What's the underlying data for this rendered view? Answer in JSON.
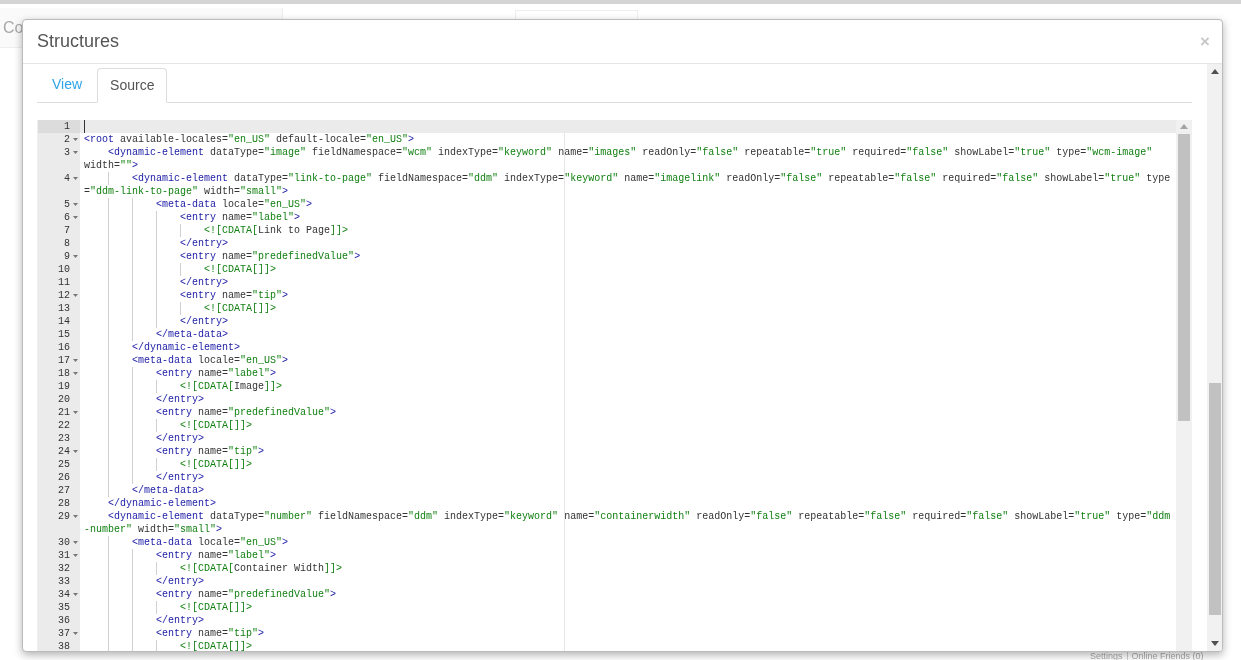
{
  "background": {
    "heading": "Co",
    "footer": [
      "Settings",
      "Online Friends (0)"
    ]
  },
  "dialog": {
    "title": "Structures",
    "close": "×",
    "tabs": [
      {
        "label": "View",
        "selected": false
      },
      {
        "label": "Source",
        "selected": true
      }
    ],
    "editor": {
      "lines": [
        {
          "number": "1",
          "foldable": false,
          "active": true
        },
        {
          "number": "2",
          "foldable": true,
          "active": false,
          "text": "<root available-locales=\"en_US\" default-locale=\"en_US\">"
        },
        {
          "number": "3",
          "foldable": true,
          "active": false,
          "text": "    <dynamic-element dataType=\"image\" fieldNamespace=\"wcm\" indexType=\"keyword\" name=\"images\" readOnly=\"false\" repeatable=\"true\" required=\"false\" showLabel=\"true\" type=\"wcm-image\"",
          "wrap": "width=\"\">"
        },
        {
          "number": "4",
          "foldable": true,
          "active": false,
          "text": "        <dynamic-element dataType=\"link-to-page\" fieldNamespace=\"ddm\" indexType=\"keyword\" name=\"imagelink\" readOnly=\"false\" repeatable=\"false\" required=\"false\" showLabel=\"true\" type",
          "wrap": "=\"ddm-link-to-page\" width=\"small\">"
        },
        {
          "number": "5",
          "foldable": true,
          "active": false,
          "text": "            <meta-data locale=\"en_US\">"
        },
        {
          "number": "6",
          "foldable": true,
          "active": false,
          "text": "                <entry name=\"label\">"
        },
        {
          "number": "7",
          "foldable": false,
          "active": false,
          "text": "                    <![CDATA[Link to Page]]>"
        },
        {
          "number": "8",
          "foldable": false,
          "active": false,
          "text": "                </entry>"
        },
        {
          "number": "9",
          "foldable": true,
          "active": false,
          "text": "                <entry name=\"predefinedValue\">"
        },
        {
          "number": "10",
          "foldable": false,
          "active": false,
          "text": "                    <![CDATA[]]>"
        },
        {
          "number": "11",
          "foldable": false,
          "active": false,
          "text": "                </entry>"
        },
        {
          "number": "12",
          "foldable": true,
          "active": false,
          "text": "                <entry name=\"tip\">"
        },
        {
          "number": "13",
          "foldable": false,
          "active": false,
          "text": "                    <![CDATA[]]>"
        },
        {
          "number": "14",
          "foldable": false,
          "active": false,
          "text": "                </entry>"
        },
        {
          "number": "15",
          "foldable": false,
          "active": false,
          "text": "            </meta-data>"
        },
        {
          "number": "16",
          "foldable": false,
          "active": false,
          "text": "        </dynamic-element>"
        },
        {
          "number": "17",
          "foldable": true,
          "active": false,
          "text": "        <meta-data locale=\"en_US\">"
        },
        {
          "number": "18",
          "foldable": true,
          "active": false,
          "text": "            <entry name=\"label\">"
        },
        {
          "number": "19",
          "foldable": false,
          "active": false,
          "text": "                <![CDATA[Image]]>"
        },
        {
          "number": "20",
          "foldable": false,
          "active": false,
          "text": "            </entry>"
        },
        {
          "number": "21",
          "foldable": true,
          "active": false,
          "text": "            <entry name=\"predefinedValue\">"
        },
        {
          "number": "22",
          "foldable": false,
          "active": false,
          "text": "                <![CDATA[]]>"
        },
        {
          "number": "23",
          "foldable": false,
          "active": false,
          "text": "            </entry>"
        },
        {
          "number": "24",
          "foldable": true,
          "active": false,
          "text": "            <entry name=\"tip\">"
        },
        {
          "number": "25",
          "foldable": false,
          "active": false,
          "text": "                <![CDATA[]]>"
        },
        {
          "number": "26",
          "foldable": false,
          "active": false,
          "text": "            </entry>"
        },
        {
          "number": "27",
          "foldable": false,
          "active": false,
          "text": "        </meta-data>"
        },
        {
          "number": "28",
          "foldable": false,
          "active": false,
          "text": "    </dynamic-element>"
        },
        {
          "number": "29",
          "foldable": true,
          "active": false,
          "text": "    <dynamic-element dataType=\"number\" fieldNamespace=\"ddm\" indexType=\"keyword\" name=\"containerwidth\" readOnly=\"false\" repeatable=\"false\" required=\"false\" showLabel=\"true\" type=\"ddm",
          "wrap": "-number\" width=\"small\">"
        },
        {
          "number": "30",
          "foldable": true,
          "active": false,
          "text": "        <meta-data locale=\"en_US\">"
        },
        {
          "number": "31",
          "foldable": true,
          "active": false,
          "text": "            <entry name=\"label\">"
        },
        {
          "number": "32",
          "foldable": false,
          "active": false,
          "text": "                <![CDATA[Container Width]]>"
        },
        {
          "number": "33",
          "foldable": false,
          "active": false,
          "text": "            </entry>"
        },
        {
          "number": "34",
          "foldable": true,
          "active": false,
          "text": "            <entry name=\"predefinedValue\">"
        },
        {
          "number": "35",
          "foldable": false,
          "active": false,
          "text": "                <![CDATA[]]>"
        },
        {
          "number": "36",
          "foldable": false,
          "active": false,
          "text": "            </entry>"
        },
        {
          "number": "37",
          "foldable": true,
          "active": false,
          "text": "            <entry name=\"tip\">"
        },
        {
          "number": "38",
          "foldable": false,
          "active": false,
          "text": "                <![CDATA[]]>"
        }
      ]
    }
  }
}
